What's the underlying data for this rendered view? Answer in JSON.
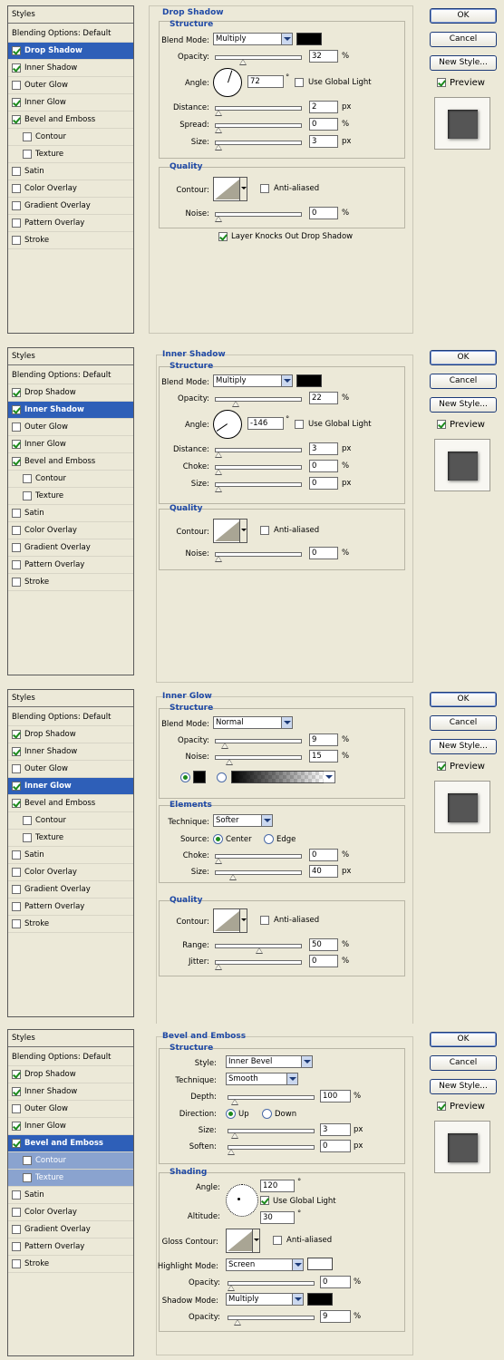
{
  "dialog": {
    "styles_header": "Styles",
    "ok": "OK",
    "cancel": "Cancel",
    "new_style": "New Style...",
    "preview": "Preview"
  },
  "panels": [
    {
      "styles_list": [
        {
          "label": "Blending Options: Default",
          "type": "hdr"
        },
        {
          "label": "Drop Shadow",
          "checked": true,
          "selected": true
        },
        {
          "label": "Inner Shadow",
          "checked": true
        },
        {
          "label": "Outer Glow",
          "checked": false
        },
        {
          "label": "Inner Glow",
          "checked": true
        },
        {
          "label": "Bevel and Emboss",
          "checked": true
        },
        {
          "label": "Contour",
          "checked": false,
          "indent": true
        },
        {
          "label": "Texture",
          "checked": false,
          "indent": true
        },
        {
          "label": "Satin",
          "checked": false
        },
        {
          "label": "Color Overlay",
          "checked": false
        },
        {
          "label": "Gradient Overlay",
          "checked": false
        },
        {
          "label": "Pattern Overlay",
          "checked": false
        },
        {
          "label": "Stroke",
          "checked": false
        }
      ],
      "title": "Drop Shadow",
      "structure": "Structure",
      "blend_mode_label": "Blend Mode:",
      "blend_mode": "Multiply",
      "opacity_label": "Opacity:",
      "opacity": "32",
      "opacity_pct": 32,
      "angle_label": "Angle:",
      "angle": "72",
      "use_global_light": "Use Global Light",
      "distance_label": "Distance:",
      "distance": "2",
      "spread_label": "Spread:",
      "spread": "0",
      "size_label": "Size:",
      "size": "3",
      "quality": "Quality",
      "contour_label": "Contour:",
      "anti_aliased": "Anti-aliased",
      "noise_label": "Noise:",
      "noise": "0",
      "layer_knocks_out": "Layer Knocks Out Drop Shadow",
      "unit_pct": "%",
      "unit_px": "px"
    },
    {
      "styles_list": [
        {
          "label": "Blending Options: Default",
          "type": "hdr"
        },
        {
          "label": "Drop Shadow",
          "checked": true
        },
        {
          "label": "Inner Shadow",
          "checked": true,
          "selected": true
        },
        {
          "label": "Outer Glow",
          "checked": false
        },
        {
          "label": "Inner Glow",
          "checked": true
        },
        {
          "label": "Bevel and Emboss",
          "checked": true
        },
        {
          "label": "Contour",
          "checked": false,
          "indent": true
        },
        {
          "label": "Texture",
          "checked": false,
          "indent": true
        },
        {
          "label": "Satin",
          "checked": false
        },
        {
          "label": "Color Overlay",
          "checked": false
        },
        {
          "label": "Gradient Overlay",
          "checked": false
        },
        {
          "label": "Pattern Overlay",
          "checked": false
        },
        {
          "label": "Stroke",
          "checked": false
        }
      ],
      "title": "Inner Shadow",
      "structure": "Structure",
      "blend_mode_label": "Blend Mode:",
      "blend_mode": "Multiply",
      "opacity_label": "Opacity:",
      "opacity": "22",
      "angle_label": "Angle:",
      "angle": "-146",
      "use_global_light": "Use Global Light",
      "distance_label": "Distance:",
      "distance": "3",
      "choke_label": "Choke:",
      "choke": "0",
      "size_label": "Size:",
      "size": "0",
      "quality": "Quality",
      "contour_label": "Contour:",
      "anti_aliased": "Anti-aliased",
      "noise_label": "Noise:",
      "noise": "0",
      "unit_pct": "%",
      "unit_px": "px"
    },
    {
      "styles_list": [
        {
          "label": "Blending Options: Default",
          "type": "hdr"
        },
        {
          "label": "Drop Shadow",
          "checked": true
        },
        {
          "label": "Inner Shadow",
          "checked": true
        },
        {
          "label": "Outer Glow",
          "checked": false
        },
        {
          "label": "Inner Glow",
          "checked": true,
          "selected": true
        },
        {
          "label": "Bevel and Emboss",
          "checked": true
        },
        {
          "label": "Contour",
          "checked": false,
          "indent": true
        },
        {
          "label": "Texture",
          "checked": false,
          "indent": true
        },
        {
          "label": "Satin",
          "checked": false
        },
        {
          "label": "Color Overlay",
          "checked": false
        },
        {
          "label": "Gradient Overlay",
          "checked": false
        },
        {
          "label": "Pattern Overlay",
          "checked": false
        },
        {
          "label": "Stroke",
          "checked": false
        }
      ],
      "title": "Inner Glow",
      "structure": "Structure",
      "blend_mode_label": "Blend Mode:",
      "blend_mode": "Normal",
      "opacity_label": "Opacity:",
      "opacity": "9",
      "noise_label": "Noise:",
      "noise": "15",
      "elements": "Elements",
      "technique_label": "Technique:",
      "technique": "Softer",
      "source_label": "Source:",
      "center": "Center",
      "edge": "Edge",
      "choke_label": "Choke:",
      "choke": "0",
      "size_label": "Size:",
      "size": "40",
      "quality": "Quality",
      "contour_label": "Contour:",
      "anti_aliased": "Anti-aliased",
      "range_label": "Range:",
      "range": "50",
      "jitter_label": "Jitter:",
      "jitter": "0",
      "unit_pct": "%",
      "unit_px": "px"
    },
    {
      "styles_list": [
        {
          "label": "Blending Options: Default",
          "type": "hdr"
        },
        {
          "label": "Drop Shadow",
          "checked": true
        },
        {
          "label": "Inner Shadow",
          "checked": true
        },
        {
          "label": "Outer Glow",
          "checked": false
        },
        {
          "label": "Inner Glow",
          "checked": true
        },
        {
          "label": "Bevel and Emboss",
          "checked": true,
          "selected": true
        },
        {
          "label": "Contour",
          "checked": false,
          "indent": true,
          "sub": true
        },
        {
          "label": "Texture",
          "checked": false,
          "indent": true,
          "sub": true
        },
        {
          "label": "Satin",
          "checked": false
        },
        {
          "label": "Color Overlay",
          "checked": false
        },
        {
          "label": "Gradient Overlay",
          "checked": false
        },
        {
          "label": "Pattern Overlay",
          "checked": false
        },
        {
          "label": "Stroke",
          "checked": false
        }
      ],
      "title": "Bevel and Emboss",
      "structure": "Structure",
      "style_label": "Style:",
      "style": "Inner Bevel",
      "technique_label": "Technique:",
      "technique": "Smooth",
      "depth_label": "Depth:",
      "depth": "100",
      "direction_label": "Direction:",
      "up": "Up",
      "down": "Down",
      "size_label": "Size:",
      "size": "3",
      "soften_label": "Soften:",
      "soften": "0",
      "shading": "Shading",
      "angle_label": "Angle:",
      "angle": "120",
      "use_global_light": "Use Global Light",
      "altitude_label": "Altitude:",
      "altitude": "30",
      "gloss_contour_label": "Gloss Contour:",
      "anti_aliased": "Anti-aliased",
      "highlight_mode_label": "Highlight Mode:",
      "highlight_mode": "Screen",
      "opacity_label": "Opacity:",
      "highlight_opacity": "0",
      "shadow_mode_label": "Shadow Mode:",
      "shadow_mode": "Multiply",
      "shadow_opacity": "9",
      "unit_pct": "%",
      "unit_px": "px",
      "degree": "°"
    }
  ]
}
